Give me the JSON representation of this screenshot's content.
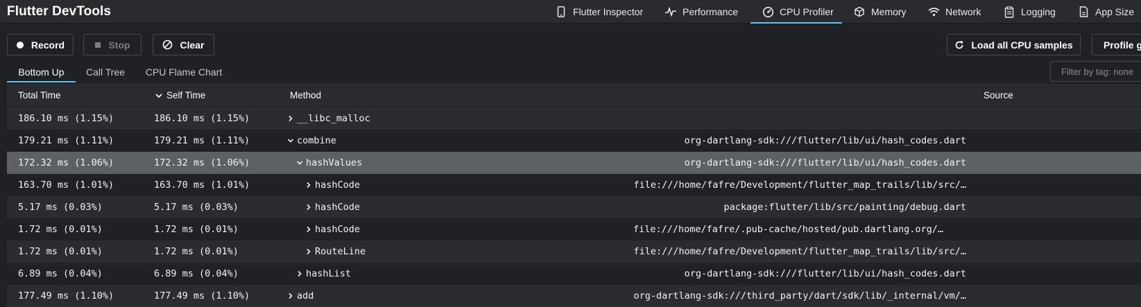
{
  "app": {
    "title": "Flutter DevTools"
  },
  "nav": {
    "tabs": [
      {
        "label": "Flutter Inspector",
        "icon": "phone-icon"
      },
      {
        "label": "Performance",
        "icon": "pulse-icon"
      },
      {
        "label": "CPU Profiler",
        "icon": "gauge-icon",
        "active": true
      },
      {
        "label": "Memory",
        "icon": "box-icon"
      },
      {
        "label": "Network",
        "icon": "wifi-icon"
      },
      {
        "label": "Logging",
        "icon": "clipboard-icon"
      },
      {
        "label": "App Size",
        "icon": "file-icon"
      }
    ]
  },
  "toolbar": {
    "record_label": "Record",
    "stop_label": "Stop",
    "clear_label": "Clear",
    "load_label": "Load all CPU samples",
    "profile_label": "Profile gr"
  },
  "subtabs": [
    {
      "label": "Bottom Up",
      "active": true
    },
    {
      "label": "Call Tree"
    },
    {
      "label": "CPU Flame Chart"
    }
  ],
  "filter": {
    "placeholder": "Filter by tag: none"
  },
  "table": {
    "columns": {
      "total": "Total Time",
      "self": "Self Time",
      "method": "Method",
      "source": "Source"
    },
    "sort_column": "self",
    "rows": [
      {
        "total": "186.10 ms (1.15%)",
        "self": "186.10 ms (1.15%)",
        "method": "__libc_malloc",
        "source": "",
        "depth": 0,
        "expanded": false
      },
      {
        "total": "179.21 ms (1.11%)",
        "self": "179.21 ms (1.11%)",
        "method": "combine",
        "source": "org-dartlang-sdk:///flutter/lib/ui/hash_codes.dart",
        "depth": 0,
        "expanded": true
      },
      {
        "total": "172.32 ms (1.06%)",
        "self": "172.32 ms (1.06%)",
        "method": "hashValues",
        "source": "org-dartlang-sdk:///flutter/lib/ui/hash_codes.dart",
        "depth": 1,
        "expanded": true,
        "selected": true
      },
      {
        "total": "163.70 ms (1.01%)",
        "self": "163.70 ms (1.01%)",
        "method": "hashCode",
        "source": "file:///home/fafre/Development/flutter_map_trails/lib/src/…",
        "depth": 2,
        "expanded": false
      },
      {
        "total": "5.17 ms (0.03%)",
        "self": "5.17 ms (0.03%)",
        "method": "hashCode",
        "source": "package:flutter/lib/src/painting/debug.dart",
        "depth": 2,
        "expanded": false
      },
      {
        "total": "1.72 ms (0.01%)",
        "self": "1.72 ms (0.01%)",
        "method": "hashCode",
        "source": "file:///home/fafre/.pub-cache/hosted/pub.dartlang.org/…",
        "depth": 2,
        "expanded": false,
        "source_pad": true
      },
      {
        "total": "1.72 ms (0.01%)",
        "self": "1.72 ms (0.01%)",
        "method": "RouteLine",
        "source": "file:///home/fafre/Development/flutter_map_trails/lib/src/…",
        "depth": 2,
        "expanded": false
      },
      {
        "total": "6.89 ms (0.04%)",
        "self": "6.89 ms (0.04%)",
        "method": "hashList",
        "source": "org-dartlang-sdk:///flutter/lib/ui/hash_codes.dart",
        "depth": 1,
        "expanded": false
      },
      {
        "total": "177.49 ms (1.10%)",
        "self": "177.49 ms (1.10%)",
        "method": "add",
        "source": "org-dartlang-sdk:///third_party/dart/sdk/lib/_internal/vm/…",
        "depth": 0,
        "expanded": false
      }
    ]
  }
}
